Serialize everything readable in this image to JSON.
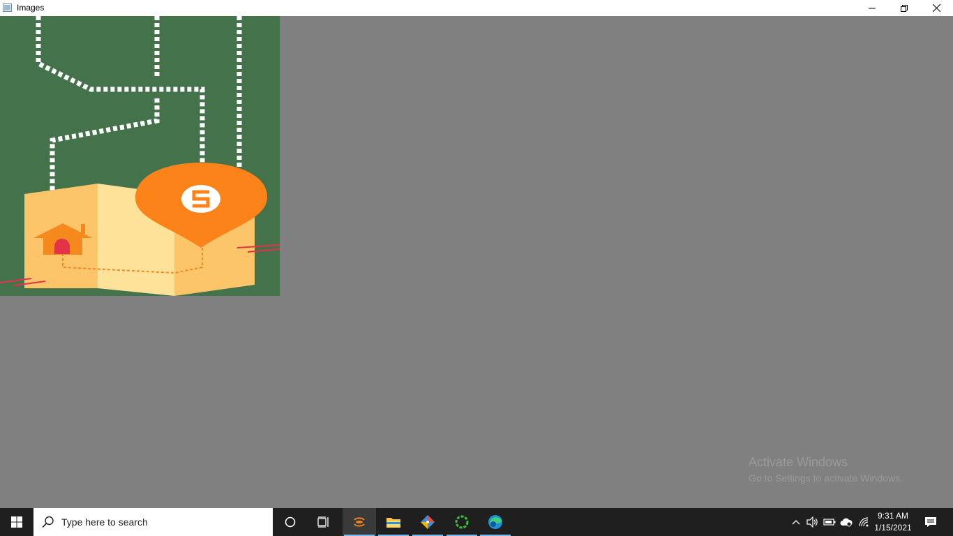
{
  "window": {
    "title": "Images",
    "icon": "window-app-icon",
    "controls": {
      "minimize": "minimize-icon",
      "maximize": "restore-icon",
      "close": "close-icon"
    }
  },
  "image": {
    "description_icon": "map-location-illustration",
    "colors": {
      "background": "#44734b",
      "map_light": "#ffe29a",
      "map_dark": "#fcc56a",
      "pin": "#fb8319",
      "house": "#f5891e",
      "door": "#e3324a",
      "path": "#ffffff"
    }
  },
  "watermark": {
    "title": "Activate Windows",
    "subtitle": "Go to Settings to activate Windows."
  },
  "taskbar": {
    "search_placeholder": "Type here to search",
    "apps": [
      {
        "name": "cortana-icon",
        "active": false
      },
      {
        "name": "task-view-icon",
        "active": false
      },
      {
        "name": "app-active-icon",
        "active": true
      },
      {
        "name": "file-explorer-icon",
        "active": false
      },
      {
        "name": "git-app-icon",
        "active": false
      },
      {
        "name": "loading-ring-icon",
        "active": false
      },
      {
        "name": "edge-browser-icon",
        "active": false
      }
    ],
    "tray": [
      "chevron-up-icon",
      "volume-icon",
      "battery-icon",
      "cloud-icon",
      "wifi-icon"
    ],
    "time": "9:31 AM",
    "date": "1/15/2021"
  }
}
